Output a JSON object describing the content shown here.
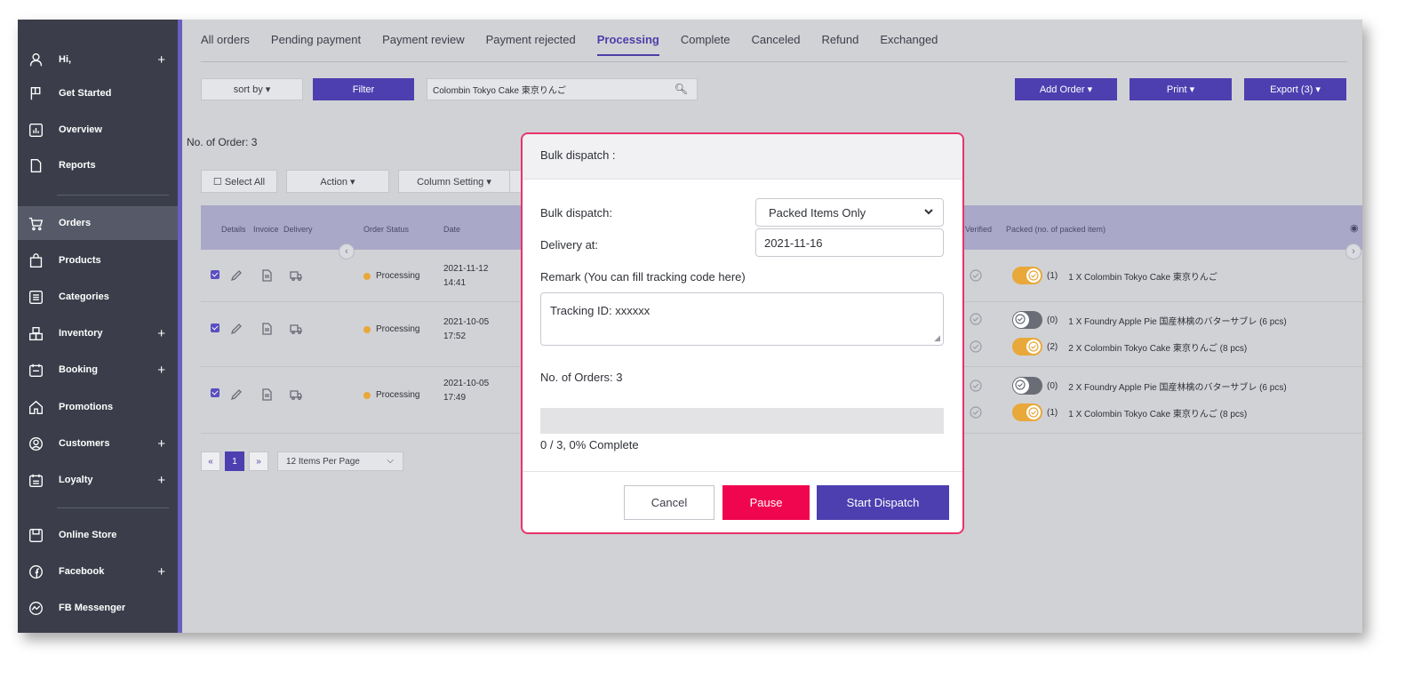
{
  "sidebar": {
    "items": [
      {
        "label": "Hi,",
        "plus": "+"
      },
      {
        "label": "Get Started"
      },
      {
        "label": "Overview"
      },
      {
        "label": "Reports"
      },
      {
        "label": "Orders"
      },
      {
        "label": "Products"
      },
      {
        "label": "Categories"
      },
      {
        "label": "Inventory",
        "plus": "+"
      },
      {
        "label": "Booking",
        "plus": "+"
      },
      {
        "label": "Promotions"
      },
      {
        "label": "Customers",
        "plus": "+"
      },
      {
        "label": "Loyalty",
        "plus": "+"
      },
      {
        "label": "Online Store"
      },
      {
        "label": "Facebook",
        "plus": "+"
      },
      {
        "label": "FB Messenger"
      }
    ],
    "accent_color": "#6a5fc1"
  },
  "tabs": [
    "All orders",
    "Pending payment",
    "Payment review",
    "Payment rejected",
    "Processing",
    "Complete",
    "Canceled",
    "Refund",
    "Exchanged"
  ],
  "active_tab": "Processing",
  "toolbar": {
    "sort_label": "sort by ▾",
    "filter_label": "Filter",
    "search_value": "Colombin Tokyo Cake 東京りんご",
    "add_order_label": "Add Order ▾",
    "print_label": "Print ▾",
    "export_label": "Export (3) ▾"
  },
  "order_count": "No. of Order: 3",
  "actions": {
    "select_all": "☐ Select All",
    "action": "Action ▾",
    "column_setting": "Column Setting ▾"
  },
  "table": {
    "headers": {
      "details": "Details",
      "invoice": "Invoice",
      "delivery": "Delivery",
      "order_status": "Order Status",
      "date": "Date",
      "verified": "Verified",
      "packed": "Packed (no. of packed item)"
    },
    "rows": [
      {
        "status": "Processing",
        "date": "2021-11-12",
        "time": "14:41",
        "items": [
          {
            "count": "(1)",
            "text": "1 X Colombin Tokyo Cake 東京りんご"
          }
        ]
      },
      {
        "status": "Processing",
        "date": "2021-10-05",
        "time": "17:52",
        "items": [
          {
            "count": "(0)",
            "text": "1 X Foundry Apple Pie 国産林檎のバターサブレ (6 pcs)"
          },
          {
            "count": "(2)",
            "text": "2 X Colombin Tokyo Cake 東京りんご (8 pcs)"
          }
        ]
      },
      {
        "status": "Processing",
        "date": "2021-10-05",
        "time": "17:49",
        "items": [
          {
            "count": "(0)",
            "text": "2 X Foundry Apple Pie 国産林檎のバターサブレ (6 pcs)"
          },
          {
            "count": "(1)",
            "text": "1 X Colombin Tokyo Cake 東京りんご (8 pcs)"
          }
        ]
      }
    ]
  },
  "pagination": {
    "prev": "«",
    "page": "1",
    "next": "»",
    "per_page": "12 Items Per Page"
  },
  "modal": {
    "title": "Bulk dispatch :",
    "bulk_label": "Bulk dispatch:",
    "bulk_value": "Packed Items Only",
    "delivery_label": "Delivery at:",
    "delivery_value": "2021-11-16",
    "remark_label": "Remark (You can fill tracking code here)",
    "remark_value": "Tracking ID: xxxxxx",
    "orders_label": "No. of Orders: 3",
    "progress": 0,
    "progress_text": "0 / 3, 0% Complete",
    "cancel_label": "Cancel",
    "pause_label": "Pause",
    "start_label": "Start Dispatch",
    "border_color": "#e8336a",
    "pause_color": "#f0064e",
    "start_color": "#4d3fb0"
  }
}
